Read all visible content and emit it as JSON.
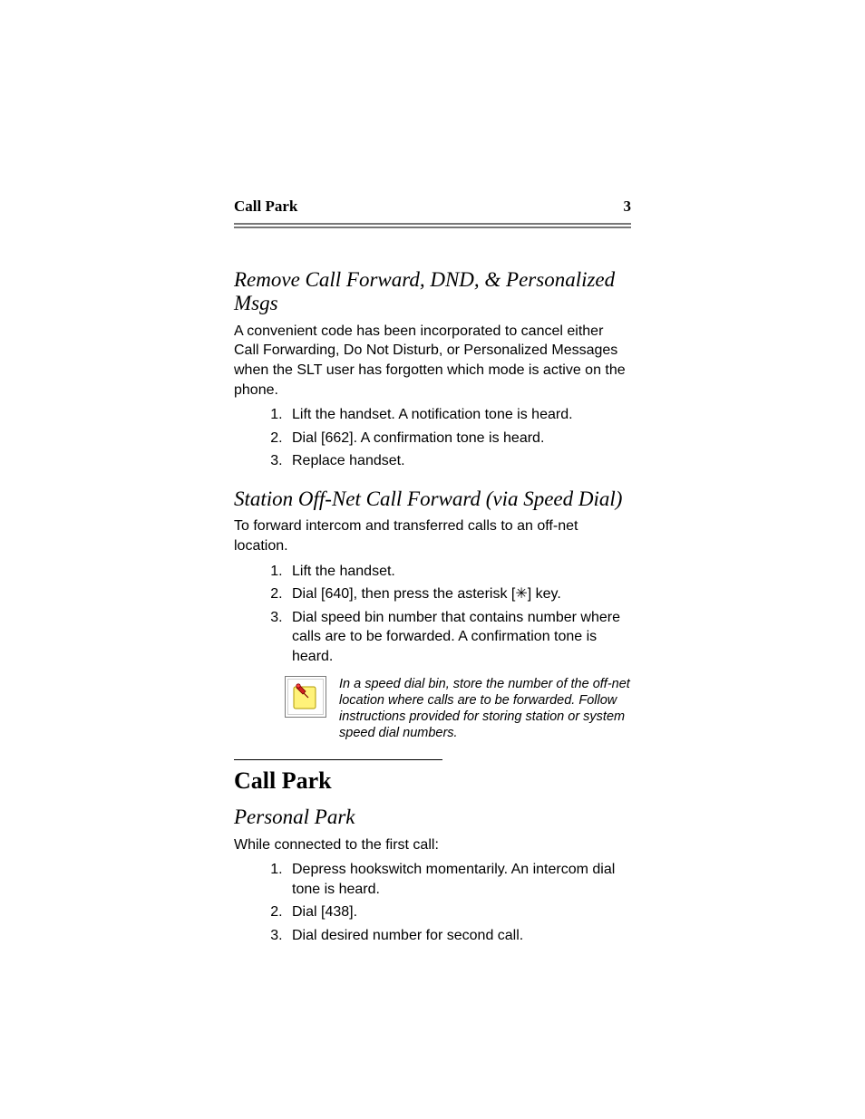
{
  "header": {
    "left": "Call Park",
    "right": "3"
  },
  "section1": {
    "heading": "Remove Call Forward, DND, & Personalized Msgs",
    "intro": "A convenient code has been incorporated to cancel either Call Forwarding, Do Not Disturb, or Personalized Messages when the SLT user has forgotten which mode is active on the phone.",
    "steps": [
      "Lift the handset. A notification tone is heard.",
      "Dial [662]. A confirmation tone is heard.",
      "Replace handset."
    ]
  },
  "section2": {
    "heading": "Station Off-Net Call Forward (via Speed Dial)",
    "intro": "To forward intercom and transferred calls to an off-net location.",
    "steps": [
      "Lift the handset.",
      "Dial [640], then press the asterisk [✳] key.",
      "Dial speed bin number that contains number where calls are to be forwarded. A confirmation tone is heard."
    ],
    "note": "In a speed dial bin, store the number of the off-net location where calls are to be forwarded. Follow instructions provided for storing station or system speed dial numbers."
  },
  "section3": {
    "heading_main": "Call Park",
    "heading_sub": "Personal Park",
    "intro": "While connected to the first call:",
    "steps": [
      "Depress hookswitch momentarily. An intercom dial tone is heard.",
      "Dial [438].",
      "Dial desired number for second call."
    ]
  }
}
